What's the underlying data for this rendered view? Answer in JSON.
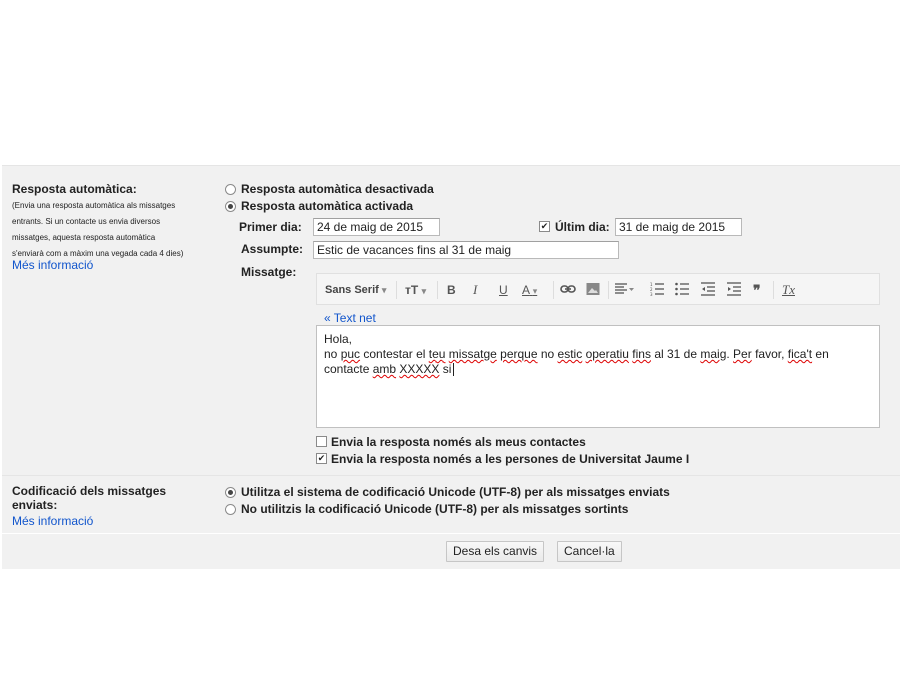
{
  "vacation": {
    "title": "Resposta automàtica:",
    "description": [
      "(Envia una resposta automàtica als missatges",
      "entrants. Si un contacte us envia diversos",
      "missatges, aquesta resposta automàtica",
      "s'enviarà com a màxim una vegada cada 4 dies)"
    ],
    "learn_more": "Més informació",
    "option_off": "Resposta automàtica desactivada",
    "option_on": "Resposta automàtica activada",
    "selected": "on",
    "first_day_label": "Primer dia:",
    "first_day_value": "24 de maig de 2015",
    "last_day_checked": true,
    "last_day_label": "Últim dia:",
    "last_day_value": "31 de maig de 2015",
    "subject_label": "Assumpte:",
    "subject_value": "Estic de vacances fins al 31 de maig",
    "message_label": "Missatge:",
    "toolbar": {
      "font": "Sans Serif",
      "font_caret": "▾",
      "size_icon": "тT",
      "bold": "B",
      "italic": "I",
      "underline": "U",
      "text_color": "A",
      "link_icon": "link-icon",
      "image_icon": "image-icon",
      "align_icon": "align-icon",
      "numbered_list_icon": "numbered-list-icon",
      "bulleted_list_icon": "bulleted-list-icon",
      "indent_less_icon": "indent-less-icon",
      "indent_more_icon": "indent-more-icon",
      "quote": "❞",
      "clear_format": "Tx"
    },
    "plain_text_link": "« Text net",
    "message_lines": [
      "Hola,",
      "no puc contestar el teu missatge perque no estic operatiu fins al 31 de maig. Per favor, fica't en",
      "contacte amb XXXXX si"
    ],
    "contacts_only_label": "Envia la resposta només als meus contactes",
    "contacts_only_checked": false,
    "org_only_label": "Envia la resposta només a les persones de Universitat Jaume I",
    "org_only_checked": true
  },
  "encoding": {
    "title_line1": "Codificació dels missatges",
    "title_line2": "enviats:",
    "learn_more": "Més informació",
    "option_utf8": "Utilitza el sistema de codificació Unicode (UTF-8) per als missatges enviats",
    "option_no_utf8": "No utilitzis la codificació Unicode (UTF-8) per als missatges sortints",
    "selected": "utf8"
  },
  "actions": {
    "save": "Desa els canvis",
    "cancel": "Cancel·la"
  }
}
